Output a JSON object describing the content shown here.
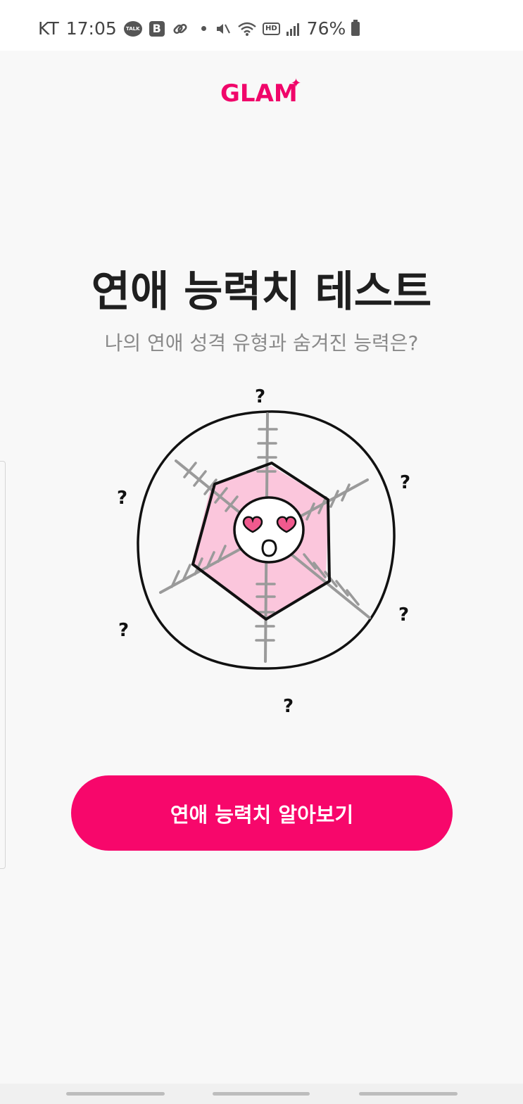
{
  "status_bar": {
    "carrier": "KT",
    "time": "17:05",
    "talk_badge": "TALK",
    "b_badge": "B",
    "hd_badge": "HD",
    "battery": "76%"
  },
  "header": {
    "logo": "GLAM",
    "logo_star": "✦"
  },
  "main": {
    "title": "연애 능력치 테스트",
    "subtitle": "나의 연애 성격 유형과 숨겨진 능력은?",
    "question_mark": "?",
    "cta_label": "연애 능력치 알아보기"
  },
  "colors": {
    "accent": "#f7076b",
    "radar_fill": "#fbc6dc",
    "heart": "#f05a8e"
  },
  "icons": [
    "chat-bubble-icon",
    "b-app-icon",
    "link-icon",
    "mute-icon",
    "wifi-icon",
    "hd-icon",
    "signal-icon",
    "battery-icon",
    "sparkle-icon"
  ]
}
